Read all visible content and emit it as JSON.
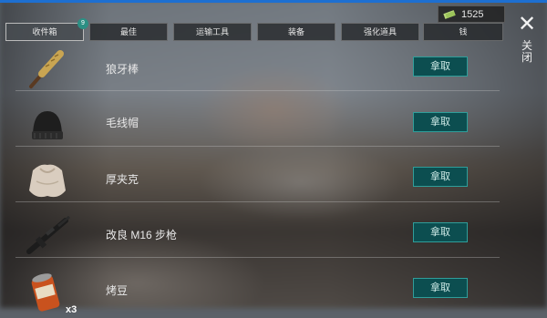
{
  "header": {
    "currency_value": "1525",
    "close_label": "关闭"
  },
  "tabs": [
    {
      "label": "收件箱",
      "badge": "9",
      "active": true
    },
    {
      "label": "最佳"
    },
    {
      "label": "运输工具"
    },
    {
      "label": "装备"
    },
    {
      "label": "强化道具"
    },
    {
      "label": "钱"
    }
  ],
  "items": [
    {
      "name": "狼牙棒",
      "button": "拿取",
      "icon": "mace-icon"
    },
    {
      "name": "毛线帽",
      "button": "拿取",
      "icon": "beanie-icon"
    },
    {
      "name": "厚夹克",
      "button": "拿取",
      "icon": "jacket-icon"
    },
    {
      "name": "改良 M16 步枪",
      "button": "拿取",
      "icon": "rifle-icon"
    },
    {
      "name": "烤豆",
      "button": "拿取",
      "icon": "beans-can-icon",
      "quantity": "x3"
    }
  ],
  "colors": {
    "accent": "#2f9e9a",
    "button_bg": "#0c4e50",
    "top_strip": "#1d6fd1"
  }
}
